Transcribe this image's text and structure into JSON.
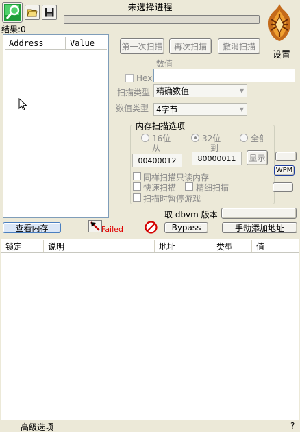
{
  "title": "未选择进程",
  "toolbar": {
    "process_icon": "computer-magnifier-icon",
    "open_icon": "folder-open-icon",
    "save_icon": "floppy-disk-icon"
  },
  "results_label": "结果:0",
  "results_list": {
    "col_address": "Address",
    "col_value": "Value"
  },
  "settings_label": "设置",
  "scan_buttons": {
    "first": "第一次扫描",
    "next": "再次扫描",
    "undo": "撤消扫描"
  },
  "value_group": {
    "value_label": "数值",
    "hex_label": "Hex",
    "scan_type_label": "扫描类型",
    "scan_type_value": "精确数值",
    "value_type_label": "数值类型",
    "value_type_value": "4字节"
  },
  "memory_scan": {
    "title": "内存扫描选项",
    "radio_16": "16位",
    "radio_32": "32位",
    "radio_all": "全部",
    "from_label": "从",
    "to_label": "到",
    "from_value": "00400012",
    "to_value": "80000011",
    "show_button": "显示",
    "opt_readonly": "同样扫描只读内存",
    "opt_fast": "快速扫描",
    "opt_precise": "精细扫描",
    "opt_pause": "扫描时暂停游戏"
  },
  "side_buttons": {
    "wpm": "WPM"
  },
  "dbvm_label": "取 dbvm 版本",
  "bottom_bar": {
    "view_memory": "查看内存",
    "failed": "Failed",
    "bypass": "Bypass",
    "manual_add": "手动添加地址"
  },
  "address_table": {
    "columns": [
      "锁定",
      "说明",
      "地址",
      "类型",
      "值"
    ]
  },
  "status_bar": {
    "advanced": "高级选项",
    "help": "?"
  },
  "colors": {
    "failed": "#e00000",
    "progress_border": "#7f7f7f"
  }
}
